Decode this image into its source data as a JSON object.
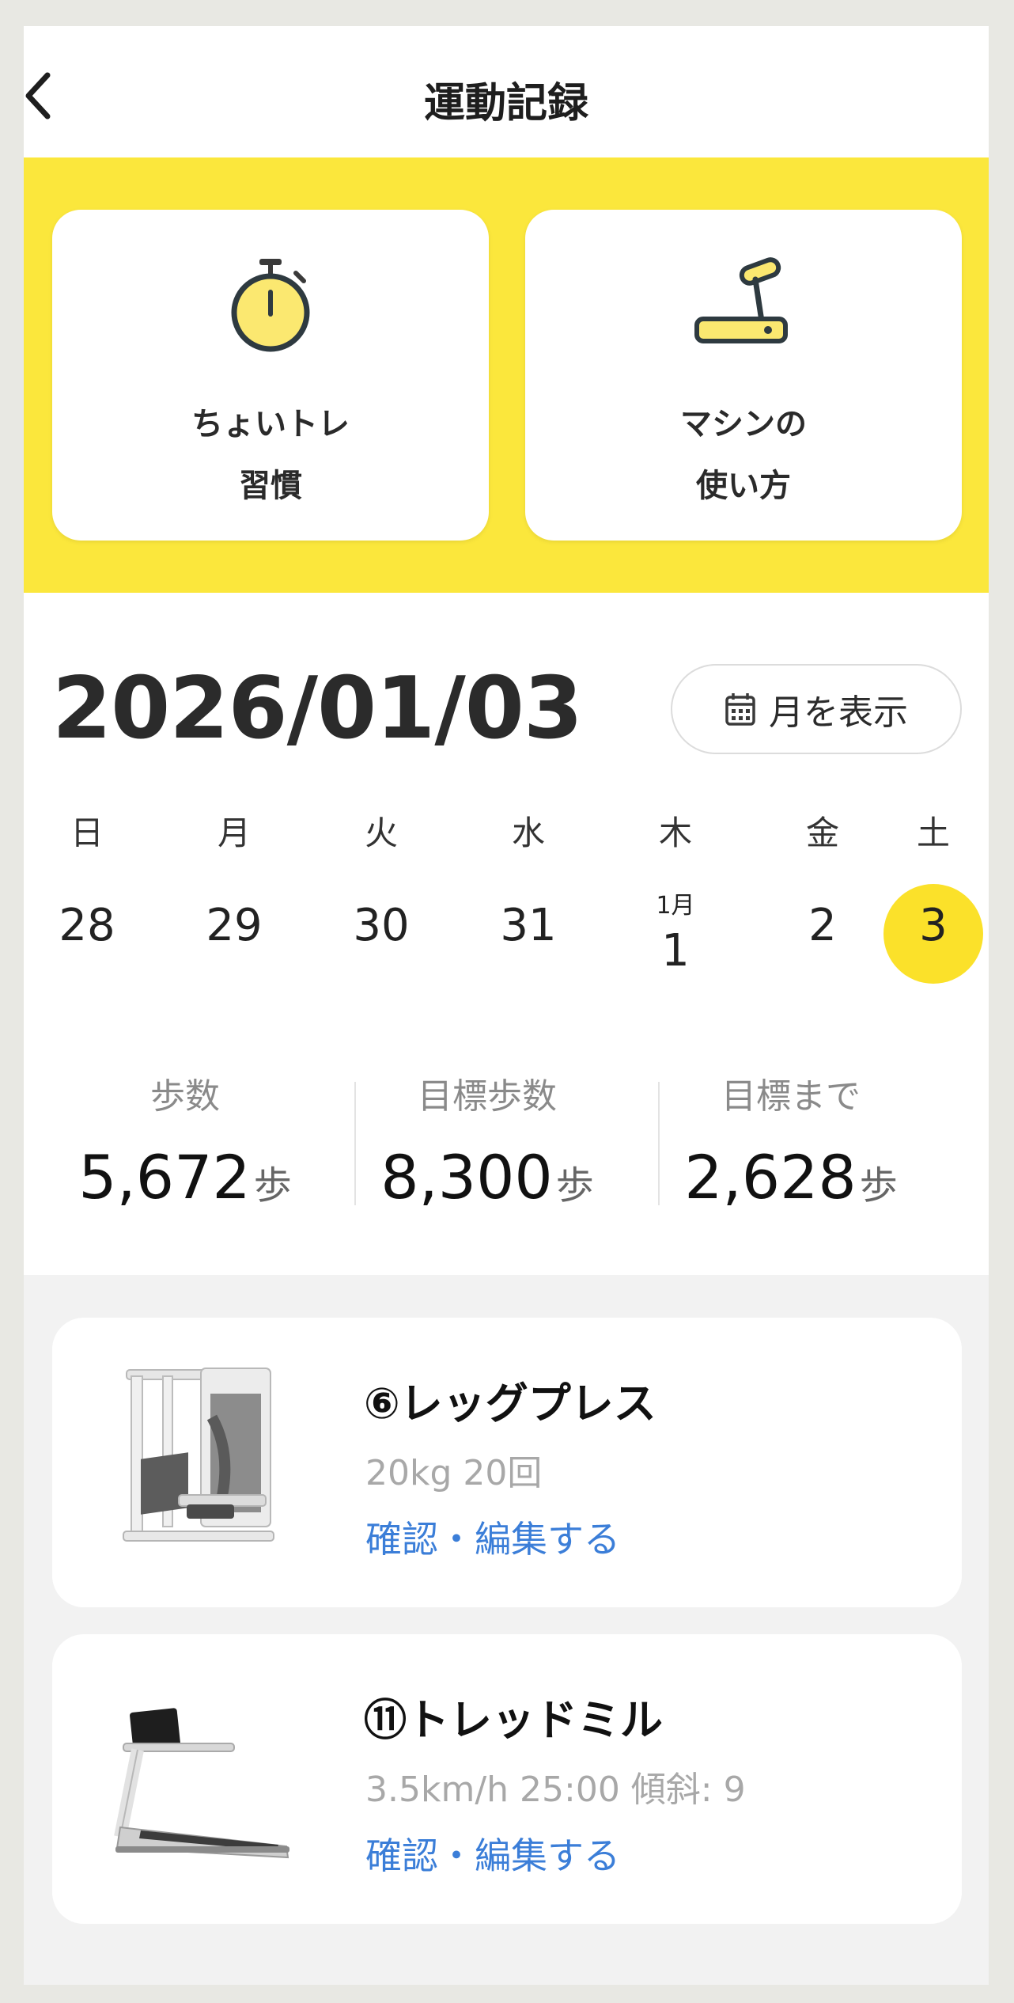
{
  "header": {
    "title": "運動記録",
    "back_icon": "chevron-left-icon"
  },
  "banner": {
    "color": "#fbe73c",
    "cards": [
      {
        "line1": "ちょいトレ",
        "line2": "習慣",
        "icon": "stopwatch-icon"
      },
      {
        "line1": "マシンの",
        "line2": "使い方",
        "icon": "treadmill-icon"
      }
    ]
  },
  "date": {
    "current": "2026/01/03",
    "month_button": "月を表示",
    "month_button_icon": "calendar-icon"
  },
  "week": {
    "days": [
      {
        "dow": "日",
        "num": "28"
      },
      {
        "dow": "月",
        "num": "29"
      },
      {
        "dow": "火",
        "num": "30"
      },
      {
        "dow": "水",
        "num": "31"
      },
      {
        "dow": "木",
        "num": "1",
        "month": "1月"
      },
      {
        "dow": "金",
        "num": "2"
      },
      {
        "dow": "土",
        "num": "3",
        "selected": true
      }
    ],
    "selected_color": "#fbe12a"
  },
  "stats": [
    {
      "label": "歩数",
      "value": "5,672",
      "unit": "歩"
    },
    {
      "label": "目標歩数",
      "value": "8,300",
      "unit": "歩"
    },
    {
      "label": "目標まで",
      "value": "2,628",
      "unit": "歩"
    }
  ],
  "machines": [
    {
      "name": "⑥レッグプレス",
      "detail": "20kg 20回",
      "link": "確認・編集する",
      "image": "leg-press-machine-image"
    },
    {
      "name": "⑪トレッドミル",
      "detail": "3.5km/h 25:00 傾斜: 9",
      "link": "確認・編集する",
      "image": "treadmill-machine-image"
    }
  ],
  "colors": {
    "link": "#3b7ed8",
    "accent": "#fbe73c"
  }
}
